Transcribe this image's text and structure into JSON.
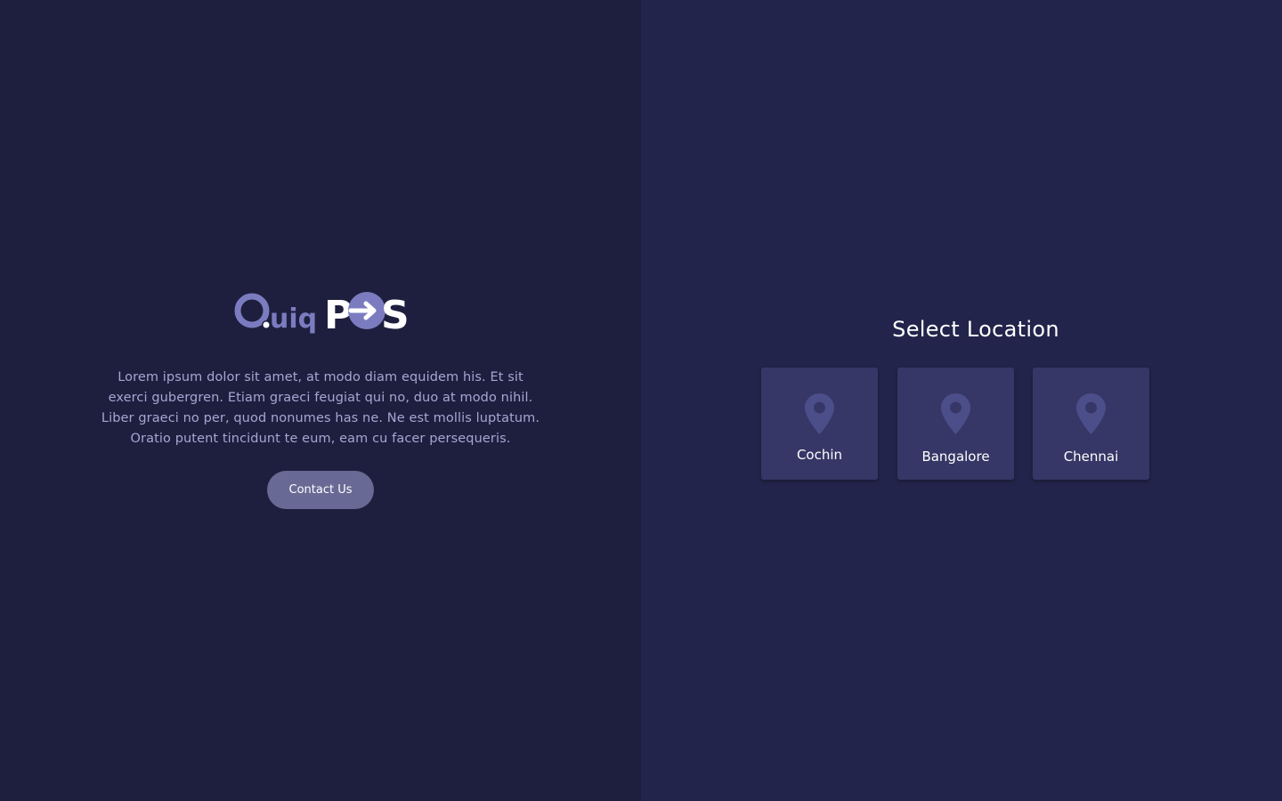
{
  "brand": {
    "logo_part1": "Quiq",
    "logo_part2": "P",
    "logo_part3": "S",
    "logo_alt": "QuiqPOS",
    "colors": {
      "logo_primary": "#7b7cc0",
      "logo_secondary": "#ffffff"
    }
  },
  "intro": {
    "text_line1": "Lorem ipsum dolor sit amet, at modo diam equidem his. Et sit",
    "text_line2": "exerci gubergren. Etiam graeci feugiat qui no, duo at modo nihil.",
    "text_line3": "Liber graeci no per, quod nonumes has ne. Ne est mollis luptatum.",
    "text_line4": "Oratio putent tincidunt te eum, eam cu facer persequeris.",
    "contact_label": "Contact Us"
  },
  "location_picker": {
    "title": "Select Location",
    "locations": [
      {
        "name": "Cochin",
        "icon": "map-pin-icon"
      },
      {
        "name": "Bangalore",
        "icon": "map-pin-icon"
      },
      {
        "name": "Chennai",
        "icon": "map-pin-icon"
      }
    ]
  },
  "theme": {
    "left_bg": "#1e1f3e",
    "right_bg": "#22244b",
    "card_bg": "#363766",
    "pin_color": "#4c4e8a",
    "button_bg": "#686a95"
  }
}
